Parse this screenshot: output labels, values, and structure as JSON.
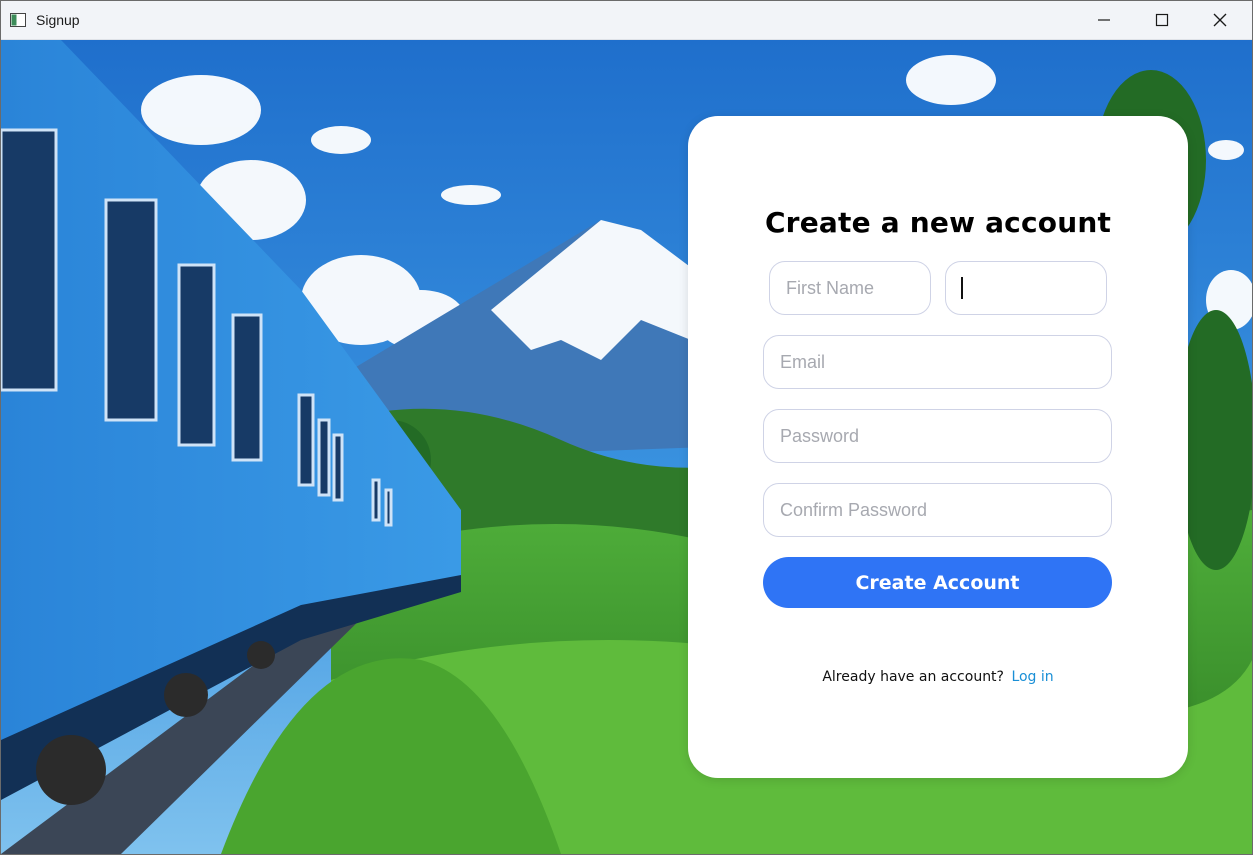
{
  "window": {
    "title": "Signup",
    "controls": [
      "minimize-icon",
      "maximize-icon",
      "close-icon"
    ]
  },
  "background": {
    "scene": "illustrated blue train passing green hills with snow-capped mountain",
    "colors": {
      "sky": "#2a7fd3",
      "train": "#2f8be0",
      "hills": "#3f9b2e",
      "snow": "#f4f8fc"
    }
  },
  "form": {
    "title": "Create a new account",
    "first_name": {
      "placeholder": "First Name",
      "value": ""
    },
    "last_name": {
      "placeholder": "",
      "value": ""
    },
    "email": {
      "placeholder": "Email",
      "value": ""
    },
    "password": {
      "placeholder": "Password",
      "value": ""
    },
    "confirm_password": {
      "placeholder": "Confirm Password",
      "value": ""
    },
    "submit_label": "Create Account",
    "footer_text": "Already have an account?",
    "login_label": "Log in"
  },
  "colors": {
    "accent": "#2f74f5",
    "link": "#1a8fd6",
    "field_border": "#cfd3e6"
  }
}
